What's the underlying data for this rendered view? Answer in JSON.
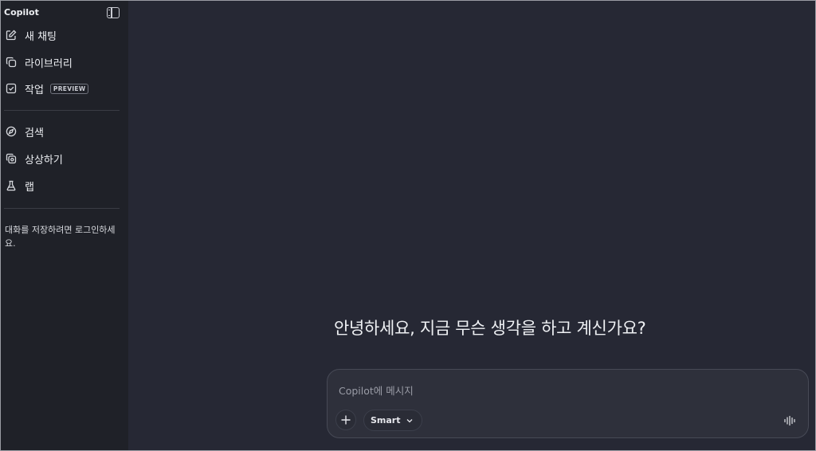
{
  "sidebar": {
    "brand": "Copilot",
    "items": [
      {
        "label": "새 채팅",
        "icon": "edit-icon"
      },
      {
        "label": "라이브러리",
        "icon": "library-icon"
      },
      {
        "label": "작업",
        "icon": "tasks-icon",
        "badge": "PREVIEW"
      },
      {
        "label": "검색",
        "icon": "compass-icon"
      },
      {
        "label": "상상하기",
        "icon": "imagine-icon"
      },
      {
        "label": "랩",
        "icon": "flask-icon"
      }
    ],
    "login_note": "대화를 저장하려면 로그인하세요."
  },
  "main": {
    "greeting": "안녕하세요, 지금 무슨 생각을 하고 계신가요?",
    "composer": {
      "placeholder": "Copilot에 메시지",
      "mode_label": "Smart"
    }
  },
  "colors": {
    "sidebar_bg": "#1f2128",
    "main_bg": "#262834",
    "composer_bg": "#2e303b"
  }
}
